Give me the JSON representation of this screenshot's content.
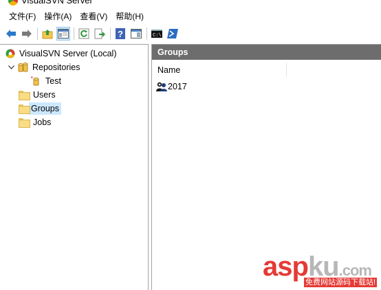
{
  "window": {
    "title": "VisualSVN Server"
  },
  "menu": [
    "文件(F)",
    "操作(A)",
    "查看(V)",
    "帮助(H)"
  ],
  "toolbar": {
    "icons": [
      "back-arrow-icon",
      "forward-arrow-icon",
      "up-folder-icon",
      "console-tree-icon",
      "refresh-icon",
      "export-list-icon",
      "help-icon",
      "action-pane-icon",
      "command-prompt-icon",
      "powershell-icon"
    ]
  },
  "tree": {
    "root": "VisualSVN Server (Local)",
    "repositories": "Repositories",
    "test": "Test",
    "users": "Users",
    "groups": "Groups",
    "jobs": "Jobs"
  },
  "content": {
    "header": "Groups",
    "column_name": "Name",
    "items": [
      "2017"
    ]
  },
  "watermark": {
    "red_text": "asp",
    "gray_text": "ku",
    "domain": ".com",
    "tagline": "免费网站源码下载站!"
  },
  "colors": {
    "selection": "#cce8ff",
    "pane_header": "#6d6d6d",
    "watermark_red": "#e53a35"
  }
}
